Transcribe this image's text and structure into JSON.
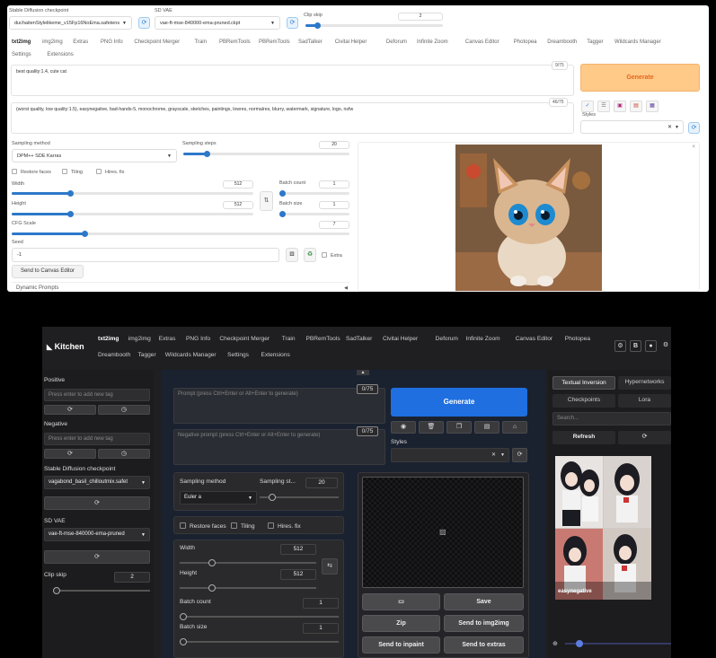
{
  "light": {
    "checkpoint_label": "Stable Diffusion checkpoint",
    "checkpoint_value": "duchaitenStylelikeme_v15Fp16NoEma.safetens",
    "vae_label": "SD VAE",
    "vae_value": "vae-ft-mse-840000-ema-pruned.ckpt",
    "clip_skip_label": "Clip skip",
    "clip_skip_value": "2",
    "tabs": [
      "txt2img",
      "img2img",
      "Extras",
      "PNG Info",
      "Checkpoint Merger",
      "Train",
      "PBRemTools",
      "PBRemTools",
      "SadTalker",
      "Civitai Helper",
      "Deforum",
      "Infinite Zoom",
      "Canvas Editor",
      "Photopea",
      "Dreambooth",
      "Tagger",
      "Wildcards Manager",
      "Settings",
      "Extensions"
    ],
    "prompt": "best quality:1.4, cute cat",
    "prompt_count": "9/75",
    "negative_prompt": "(worst quality, low quality:1.5), easynegative, bad-hands-5, monochrome, grayscale, sketches, paintings, lowres, normalres, blurry, watermark, signature, logo, nsfw",
    "negative_count": "46/75",
    "generate": "Generate",
    "styles_label": "Styles",
    "sampling_method_label": "Sampling method",
    "sampling_method_value": "DPM++ SDE Karras",
    "sampling_steps_label": "Sampling steps",
    "sampling_steps_value": "20",
    "restore_faces": "Restore faces",
    "tiling": "Tiling",
    "hires_fix": "Hires. fix",
    "width_label": "Width",
    "width_value": "512",
    "height_label": "Height",
    "height_value": "512",
    "batch_count_label": "Batch count",
    "batch_count_value": "1",
    "batch_size_label": "Batch size",
    "batch_size_value": "1",
    "cfg_label": "CFG Scale",
    "cfg_value": "7",
    "seed_label": "Seed",
    "seed_value": "-1",
    "extra": "Extra",
    "send_canvas": "Send to Canvas Editor",
    "dynamic_prompts": "Dynamic Prompts"
  },
  "dark": {
    "brand": "Kitchen",
    "tabs_row1": [
      "txt2img",
      "img2img",
      "Extras",
      "PNG Info",
      "Checkpoint Merger",
      "Train",
      "PBRemTools",
      "SadTalker",
      "Civitai Helper",
      "Deforum",
      "Infinite Zoom",
      "Canvas Editor",
      "Photopea"
    ],
    "tabs_row2": [
      "Dreambooth",
      "Tagger",
      "Wildcards Manager",
      "Settings",
      "Extensions"
    ],
    "positive_label": "Positive",
    "positive_placeholder": "Press enter to add new tag",
    "negative_label": "Negative",
    "negative_placeholder": "Press enter to add new tag",
    "checkpoint_label": "Stable Diffusion checkpoint",
    "checkpoint_value": "vagabond_basil_chilloutmix.safet",
    "vae_label": "SD VAE",
    "vae_value": "vae-ft-mse-840000-ema-pruned",
    "clip_skip_label": "Clip skip",
    "clip_skip_value": "2",
    "prompt_placeholder": "Prompt (press Ctrl+Enter or Alt+Enter to generate)",
    "prompt_count": "0/75",
    "negative_prompt_placeholder": "Negative prompt (press Ctrl+Enter or Alt+Enter to generate)",
    "negative_count": "0/75",
    "generate": "Generate",
    "styles_label": "Styles",
    "sampling_method_label": "Sampling method",
    "sampling_method_value": "Euler a",
    "sampling_steps_label": "Sampling st...",
    "sampling_steps_value": "20",
    "restore_faces": "Restore faces",
    "tiling": "Tiling",
    "hires_fix": "Hires. fix",
    "width_label": "Width",
    "width_value": "512",
    "height_label": "Height",
    "height_value": "512",
    "batch_count_label": "Batch count",
    "batch_count_value": "1",
    "batch_size_label": "Batch size",
    "batch_size_value": "1",
    "save": "Save",
    "zip": "Zip",
    "send_img2img": "Send to img2img",
    "send_inpaint": "Send to inpaint",
    "send_extras": "Send to extras",
    "right_tabs": [
      "Textual Inversion",
      "Hypernetworks",
      "Checkpoints",
      "Lora"
    ],
    "search_placeholder": "Search...",
    "refresh": "Refresh",
    "card_caption": "easynegative"
  },
  "colors": {
    "accent_orange": "#ffc988",
    "accent_blue": "#1f6fe0",
    "dark_bg": "#1f1f21"
  }
}
